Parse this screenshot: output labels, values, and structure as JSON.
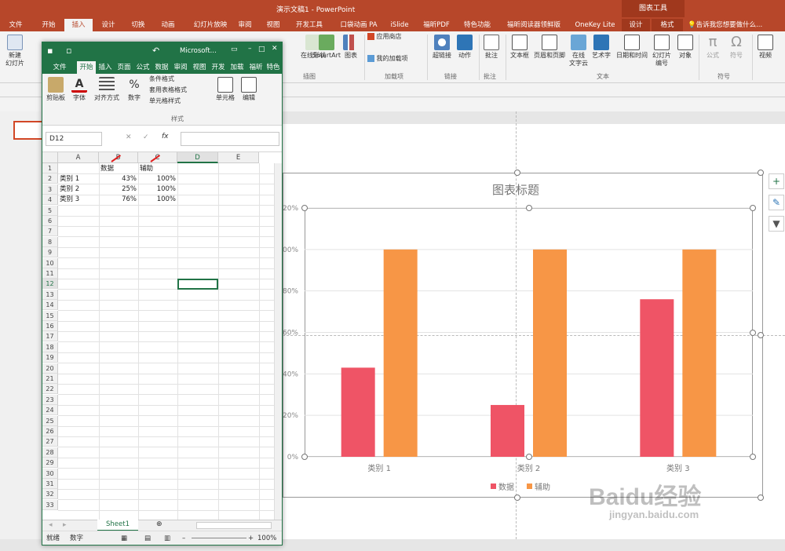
{
  "ppt": {
    "window_title": "演示文稿1 - PowerPoint",
    "context_group": "图表工具",
    "tabs": [
      "文件",
      "开始",
      "插入",
      "设计",
      "切换",
      "动画",
      "幻灯片放映",
      "审阅",
      "视图",
      "开发工具",
      "口袋动画 PA",
      "iSlide",
      "福昕PDF",
      "特色功能",
      "福昕阅读器领鲜版",
      "OneKey Lite",
      "设计",
      "格式"
    ],
    "active_tab": "插入",
    "tell_me": "告诉我您想要做什么...",
    "ribbon": {
      "new_slide": "新建",
      "new_slide2": "幻灯片",
      "new_slide3": "幻灯片",
      "shapes": "在",
      "smartart": "SmartArt",
      "chart": "图表",
      "icons_shapes": "在线形状",
      "store": "应用商店",
      "my_addins": "我的加载项",
      "hyperlink": "超链接",
      "action": "动作",
      "comment": "批注",
      "textbox": "文本框",
      "header_footer": "页眉和页脚",
      "online_text": "在线",
      "online_text2": "文字云",
      "wordart": "艺术字",
      "datetime": "日期和时间",
      "slide_number": "幻灯片",
      "slide_number2": "编号",
      "object": "对象",
      "formula": "公式",
      "symbol": "符号",
      "video": "视频",
      "group_illustrations": "插图",
      "group_addins": "加载项",
      "group_links": "链接",
      "group_comments": "批注",
      "group_text": "文本",
      "group_symbols": "符号"
    },
    "thumb_label": "演"
  },
  "excel": {
    "title": "Microsoft...",
    "tabs": [
      "文件",
      "开始",
      "插入",
      "页面",
      "公式",
      "数据",
      "审阅",
      "视图",
      "开发",
      "加载",
      "福昕",
      "特色"
    ],
    "active_tab": "开始",
    "ribbon": {
      "clipboard": "剪贴板",
      "font": "字体",
      "align": "对齐方式",
      "number": "数字",
      "cond_format": "条件格式",
      "table_format": "套用表格格式",
      "cell_style": "单元格样式",
      "cells": "单元格",
      "edit": "编辑",
      "styles_group": "样式"
    },
    "name_box": "D12",
    "fx": "fx",
    "columns": [
      "A",
      "B",
      "C",
      "D",
      "E"
    ],
    "rows": [
      "1",
      "2",
      "3",
      "4",
      "5",
      "6",
      "7",
      "8",
      "9",
      "10",
      "11",
      "12",
      "13",
      "14",
      "15",
      "16",
      "17",
      "18",
      "19",
      "20",
      "21",
      "22",
      "23",
      "24",
      "25",
      "26",
      "27",
      "28",
      "29",
      "30",
      "31",
      "32",
      "33"
    ],
    "cells": {
      "B1": "数据",
      "C1": "辅助",
      "A2": "类别 1",
      "B2": "43%",
      "C2": "100%",
      "A3": "类别 2",
      "B3": "25%",
      "C3": "100%",
      "A4": "类别 3",
      "B4": "76%",
      "C4": "100%"
    },
    "sheet_tab": "Sheet1",
    "status_ready": "就绪",
    "status_number": "数字",
    "zoom": "100%"
  },
  "chart_data": {
    "type": "bar",
    "title": "图表标题",
    "categories": [
      "类别 1",
      "类别 2",
      "类别 3"
    ],
    "series": [
      {
        "name": "数据",
        "values": [
          43,
          25,
          76
        ],
        "color": "#ef5466"
      },
      {
        "name": "辅助",
        "values": [
          100,
          100,
          100
        ],
        "color": "#f79646"
      }
    ],
    "ylim": [
      0,
      120
    ],
    "yticks": [
      "0%",
      "20%",
      "40%",
      "60%",
      "80%",
      "100%",
      "120%"
    ],
    "legend_position": "bottom",
    "grid": true
  },
  "watermark": {
    "text": "Baidu经验",
    "sub": "jingyan.baidu.com"
  }
}
